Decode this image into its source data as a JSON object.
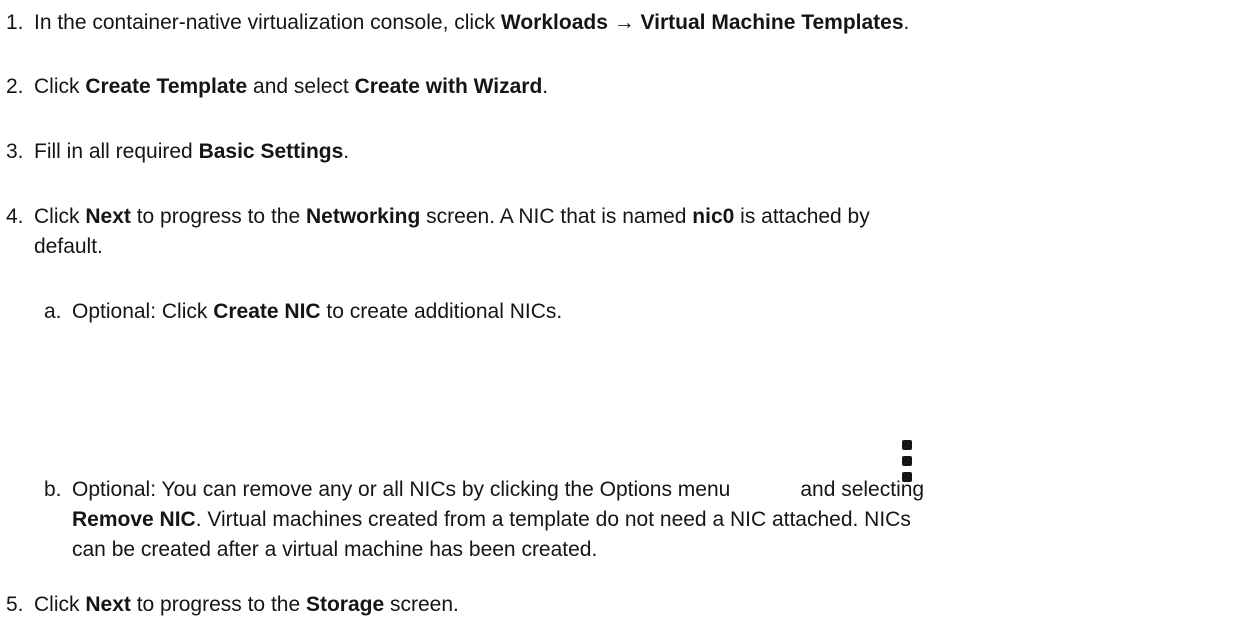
{
  "steps": [
    {
      "num": "1.",
      "parts": [
        "In the container-native virtualization console, click ",
        "Workloads",
        " → ",
        "Virtual Machine Templates",
        "."
      ]
    },
    {
      "num": "2.",
      "parts": [
        "Click ",
        "Create Template",
        " and select ",
        "Create with Wizard",
        "."
      ]
    },
    {
      "num": "3.",
      "parts": [
        "Fill in all required ",
        "Basic Settings",
        "."
      ]
    },
    {
      "num": "4.",
      "parts": [
        "Click ",
        "Next",
        " to progress to the ",
        "Networking",
        " screen. A NIC that is named ",
        "nic0",
        " is attached by"
      ],
      "line2": "default."
    },
    {
      "num": "a.",
      "parts": [
        "Optional: Click ",
        "Create NIC",
        " to create additional NICs."
      ]
    },
    {
      "num": "b.",
      "line1a": "Optional: You can remove any or all NICs by clicking the Options menu",
      "line1b": "and selecting",
      "line2": [
        "Remove NIC",
        ". Virtual machines created from a template do not need a NIC attached. NICs"
      ],
      "line3": "can be created after a virtual machine has been created."
    },
    {
      "num": "5.",
      "parts": [
        "Click ",
        "Next",
        " to progress to the ",
        "Storage",
        " screen."
      ]
    }
  ],
  "icons": {
    "options_menu": "kebab-icon"
  }
}
